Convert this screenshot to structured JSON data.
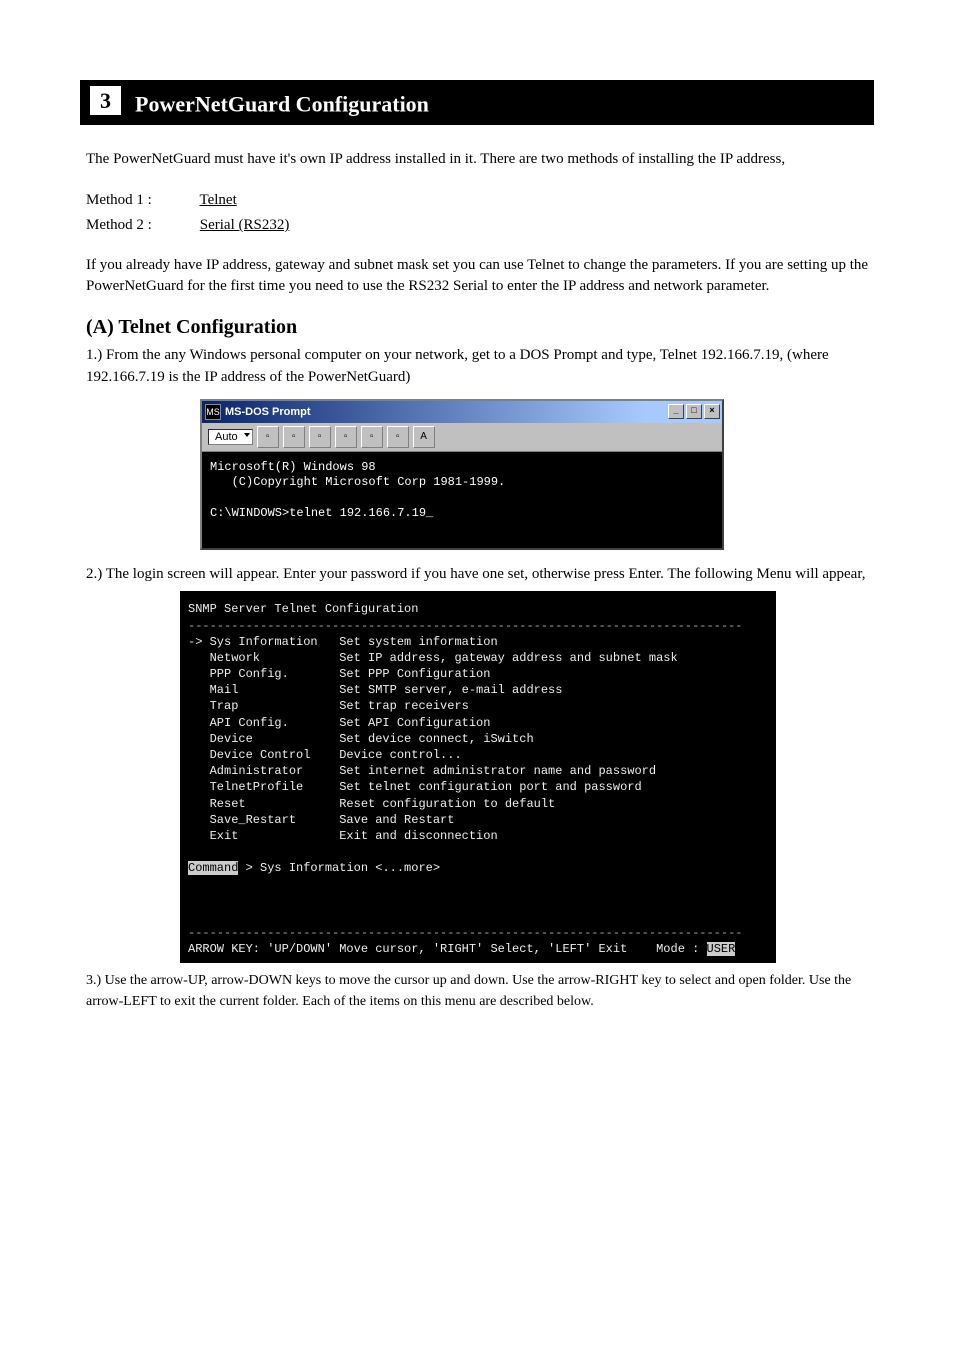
{
  "chapter": {
    "number": "3",
    "title": "PowerNetGuard Configuration"
  },
  "intro": "The PowerNetGuard must have it's own IP address installed in it. There are two methods of installing the IP address,",
  "method1_label": "Method 1 :",
  "method1_value": "Telnet",
  "method2_label": "Method 2 :",
  "method2_value": "Serial (RS232)",
  "desc": "If you already have IP address, gateway and subnet mask set you can use Telnet to change the parameters. If you are setting up the PowerNetGuard for the first time you need to use the RS232 Serial to enter the IP address and network parameter.",
  "section_a": "(A) Telnet Configuration",
  "step1": "1.) From the any Windows personal computer on your network, get to a DOS Prompt and type, Telnet 192.166.7.19, (where 192.166.7.19 is the IP address of the PowerNetGuard)",
  "doswin": {
    "title": "MS-DOS Prompt",
    "combo": "Auto",
    "lines": [
      "Microsoft(R) Windows 98",
      "   (C)Copyright Microsoft Corp 1981-1999.",
      "",
      "C:\\WINDOWS>telnet 192.166.7.19_"
    ]
  },
  "step2": "2.) The login screen will appear. Enter your password if you have one set, otherwise press Enter. The following Menu will appear,",
  "telnet": {
    "header": "SNMP Server Telnet Configuration",
    "hr": "-----------------------------------------------------------------------------",
    "menu": [
      {
        "sel": "->",
        "name": "Sys Information",
        "desc": "Set system information"
      },
      {
        "sel": "  ",
        "name": "Network",
        "desc": "Set IP address, gateway address and subnet mask"
      },
      {
        "sel": "  ",
        "name": "PPP Config.",
        "desc": "Set PPP Configuration"
      },
      {
        "sel": "  ",
        "name": "Mail",
        "desc": "Set SMTP server, e-mail address"
      },
      {
        "sel": "  ",
        "name": "Trap",
        "desc": "Set trap receivers"
      },
      {
        "sel": "  ",
        "name": "API Config.",
        "desc": "Set API Configuration"
      },
      {
        "sel": "  ",
        "name": "Device",
        "desc": "Set device connect, iSwitch"
      },
      {
        "sel": "  ",
        "name": "Device Control",
        "desc": "Device control..."
      },
      {
        "sel": "  ",
        "name": "Administrator",
        "desc": "Set internet administrator name and password"
      },
      {
        "sel": "  ",
        "name": "TelnetProfile",
        "desc": "Set telnet configuration port and password"
      },
      {
        "sel": "  ",
        "name": "Reset",
        "desc": "Reset configuration to default"
      },
      {
        "sel": "  ",
        "name": "Save_Restart",
        "desc": "Save and Restart"
      },
      {
        "sel": "  ",
        "name": "Exit",
        "desc": "Exit and disconnection"
      }
    ],
    "cmd_label": "Command",
    "cmd_text": " > Sys Information <...more>",
    "footer_keys": "ARROW KEY: 'UP/DOWN' Move cursor, 'RIGHT' Select, 'LEFT' Exit",
    "mode_label": "Mode : ",
    "mode_value": "USER"
  },
  "footnote": "3.) Use the arrow-UP, arrow-DOWN keys to move the cursor up and down. Use the arrow-RIGHT key to select and open folder. Use the arrow-LEFT to exit the current folder. Each of the items on this menu are described below."
}
